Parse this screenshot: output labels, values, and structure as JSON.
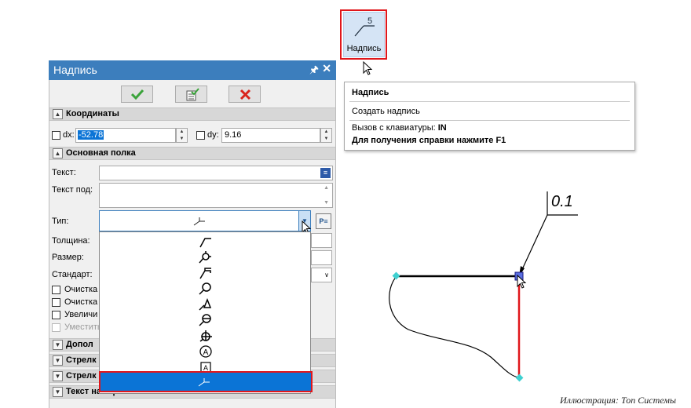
{
  "ribbon_button": {
    "label": "Надпись",
    "icon": "inscription-leader-icon",
    "icon_value": "5"
  },
  "tooltip": {
    "title": "Надпись",
    "action": "Создать надпись",
    "keyboard_label": "Вызов с клавиатуры: ",
    "keyboard_value": "IN",
    "help": "Для получения справки нажмите F1"
  },
  "panel": {
    "title": "Надпись",
    "pin_icon": "pin-icon",
    "close_icon": "close-icon",
    "toolbar": {
      "ok_icon": "checkmark-icon",
      "apply_icon": "apply-checklist-icon",
      "cancel_icon": "cancel-x-icon"
    },
    "sections": {
      "coords": "Координаты",
      "main_shelf": "Основная полка",
      "additional": "Допол",
      "arrow1": "Стрелк",
      "arrow2": "Стрелк",
      "arrow_text": "Текст на стрелке"
    },
    "coords": {
      "dx_label": "dx:",
      "dx_value": "-52.78",
      "dy_label": "dy:",
      "dy_value": "9.16"
    },
    "fields": {
      "text_label": "Текст:",
      "text_below_label": "Текст под:",
      "type_label": "Тип:",
      "thickness_label": "Толщина:",
      "size_label": "Размер:",
      "standard_label": "Стандарт:"
    },
    "checkboxes": [
      "Очистка",
      "Очистка",
      "Увеличи",
      "Уместить"
    ],
    "type_dropdown": {
      "options_icons": [
        "leader-angle-icon",
        "leader-circle-tick-icon",
        "leader-step-icon",
        "leader-circle-icon",
        "leader-triangle-icon",
        "leader-circle-bar-icon",
        "leader-circle-cross-icon",
        "circled-a-icon",
        "boxed-a-icon",
        "leader-simple-icon"
      ],
      "boxed_letter": "A",
      "circled_letter": "A",
      "selected_index": 9
    }
  },
  "drawing": {
    "leader_text": "0.1"
  },
  "caption": "Иллюстрация: Топ Системы",
  "colors": {
    "accent": "#3c7ebd",
    "highlight": "#e0161b",
    "selected": "#0b74d6",
    "ok_green": "#3aa33a",
    "cancel_red": "#d9241c",
    "node": "#3fd0d0"
  }
}
